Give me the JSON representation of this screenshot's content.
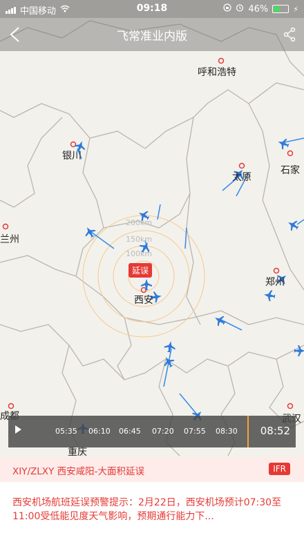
{
  "status_bar": {
    "carrier": "中国移动",
    "time": "09:18",
    "battery": "46%",
    "battery_level": 0.46
  },
  "header": {
    "title": "飞常准业内版",
    "back_icon": "chevron-left-icon",
    "share_icon": "share-icon"
  },
  "map": {
    "cities": [
      "呼和浩特",
      "银川",
      "太原",
      "石家",
      "兰州",
      "郑州",
      "西安",
      "成都",
      "武汉",
      "重庆"
    ],
    "range_rings": [
      "200km",
      "150km",
      "100km"
    ],
    "delay_tag": "延误",
    "colors": {
      "plane": "#2f7ad9",
      "track": "#3a8ee6",
      "ring": "#f6c98a",
      "alert": "#e53935"
    }
  },
  "timeline": {
    "ticks": [
      "05:35",
      "06:10",
      "06:45",
      "07:20",
      "07:55",
      "08:30"
    ],
    "current_time": "08:52"
  },
  "airport": {
    "code_name": "XIY/ZLXY 西安咸阳-大面积延误",
    "badge": "IFR"
  },
  "notice": {
    "text": "西安机场航班延误预警提示：2月22日，西安机场预计07:30至11:00受低能见度天气影响，预期通行能力下..."
  }
}
